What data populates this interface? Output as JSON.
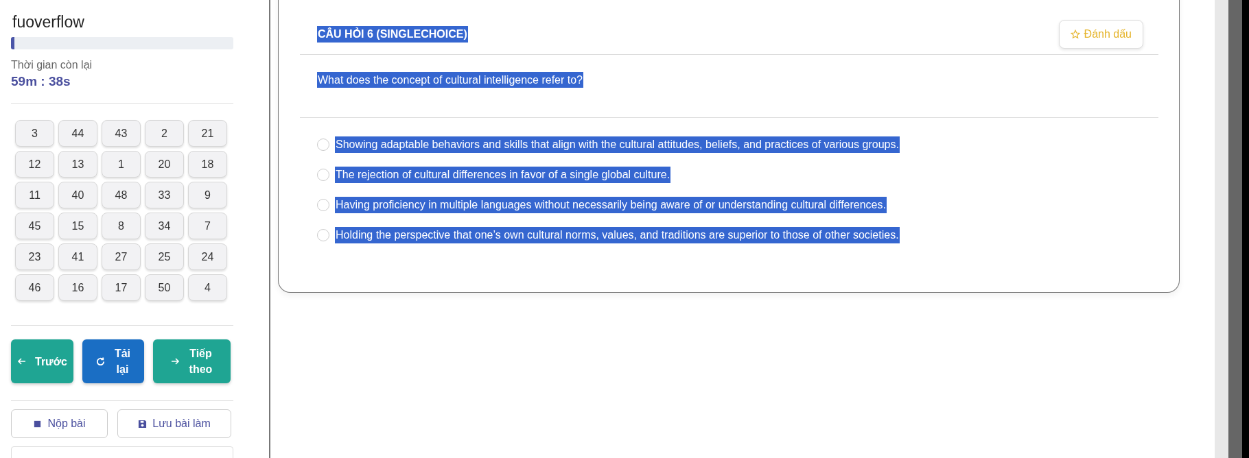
{
  "sidebar": {
    "title": "fuoverflow",
    "progress": {
      "level": 0.015
    },
    "timer_label": "Thời gian còn lại",
    "timer_value": "59m : 38s",
    "question_numbers": [
      {
        "label": "3"
      },
      {
        "label": "44"
      },
      {
        "label": "43"
      },
      {
        "label": "2"
      },
      {
        "label": "21"
      },
      {
        "label": "12"
      },
      {
        "label": "13"
      },
      {
        "label": "1"
      },
      {
        "label": "20"
      },
      {
        "label": "18"
      },
      {
        "label": "11"
      },
      {
        "label": "40"
      },
      {
        "label": "48"
      },
      {
        "label": "33"
      },
      {
        "label": "9"
      },
      {
        "label": "45"
      },
      {
        "label": "15"
      },
      {
        "label": "8"
      },
      {
        "label": "34"
      },
      {
        "label": "7"
      },
      {
        "label": "23"
      },
      {
        "label": "41"
      },
      {
        "label": "27"
      },
      {
        "label": "25"
      },
      {
        "label": "24"
      },
      {
        "label": "46"
      },
      {
        "label": "16"
      },
      {
        "label": "17"
      },
      {
        "label": "50"
      },
      {
        "label": "4"
      }
    ],
    "nav_buttons": [
      {
        "label": "Trước",
        "kind": "prev"
      },
      {
        "label": "Tải lại",
        "kind": "reload"
      },
      {
        "label": "Tiếp theo",
        "kind": "next"
      }
    ],
    "action_buttons": [
      {
        "label": "Nộp bài",
        "kind": "submit"
      },
      {
        "label": "Lưu bài làm",
        "kind": "save"
      }
    ]
  },
  "question": {
    "header": "CÂU HỎI 6 (SINGLECHOICE)",
    "mark_button": "Đánh dấu",
    "text": "What does the concept of cultural intelligence refer to?",
    "options": [
      {
        "text": "Showing adaptable behaviors and skills that align with the cultural attitudes, beliefs, and practices of various groups.",
        "selected": false
      },
      {
        "text": "The rejection of cultural differences in favor of a single global culture.",
        "selected": false
      },
      {
        "text": "Having proficiency in multiple languages without necessarily being aware of or understanding cultural differences.",
        "selected": false
      },
      {
        "text": "Holding the perspective that one’s own cultural norms, values, and traditions are superior to those of other societies.",
        "selected": false
      }
    ]
  }
}
